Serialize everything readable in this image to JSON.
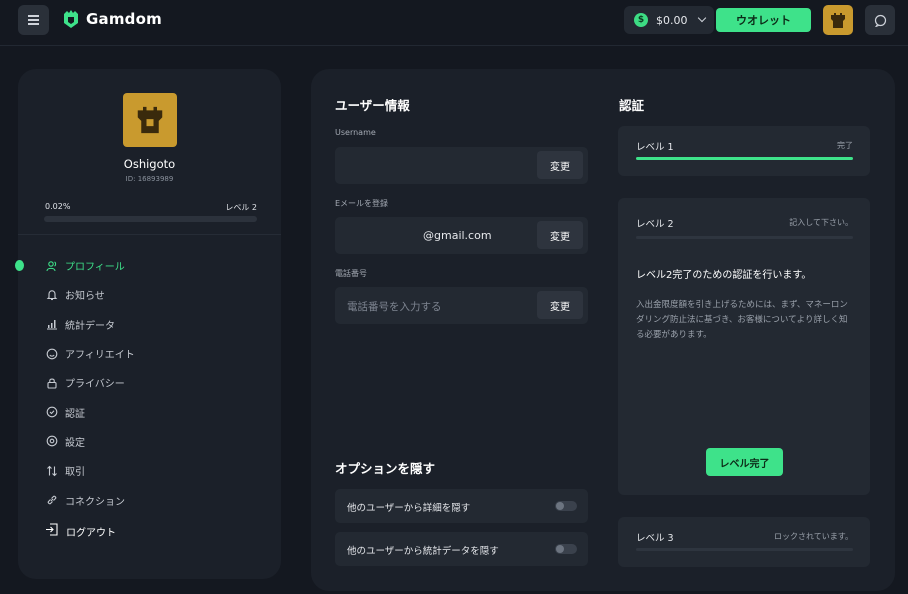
{
  "topbar": {
    "brand": "Gamdom",
    "balance": "$0.00",
    "coin_symbol": "$",
    "wallet_label": "ウオレット",
    "accent_color": "#3ee28a"
  },
  "profile": {
    "username": "Oshigoto",
    "user_id": "ID: 16893989",
    "progress_label": "0.02%",
    "progress_value": 0.02,
    "level_label": "レベル 2",
    "avatar_color": "#c99a2e"
  },
  "nav": {
    "items": [
      {
        "label": "プロフィール",
        "icon": "user-icon",
        "active": true
      },
      {
        "label": "お知らせ",
        "icon": "bell-icon"
      },
      {
        "label": "統計データ",
        "icon": "stats-icon"
      },
      {
        "label": "アフィリエイト",
        "icon": "smile-icon"
      },
      {
        "label": "プライバシー",
        "icon": "lock-icon"
      },
      {
        "label": "認証",
        "icon": "verify-icon"
      },
      {
        "label": "設定",
        "icon": "gear-icon"
      },
      {
        "label": "取引",
        "icon": "transfer-icon"
      },
      {
        "label": "コネクション",
        "icon": "link-icon"
      }
    ],
    "logout": "ログアウト"
  },
  "user_info": {
    "title": "ユーザー情報",
    "username_label": "Username",
    "username_value": "",
    "email_label": "Eメールを登録",
    "email_value": "@gmail.com",
    "phone_label": "電話番号",
    "phone_placeholder": "電話番号を入力する",
    "change_label": "変更"
  },
  "options": {
    "title": "オプションを隠す",
    "items": [
      {
        "label": "他のユーザーから詳細を隠す",
        "enabled": false
      },
      {
        "label": "他のユーザーから統計データを隠す",
        "enabled": false
      }
    ]
  },
  "verification": {
    "title": "認証",
    "level1": {
      "name": "レベル 1",
      "status": "完了",
      "progress": 1.0
    },
    "level2": {
      "name": "レベル 2",
      "status": "記入して下さい。",
      "progress": 0,
      "heading": "レベル2完了のための認証を行います。",
      "description": "入出金限度額を引き上げるためには、まず、マネーロンダリング防止法に基づき、お客様についてより詳しく知る必要があります。",
      "button": "レベル完了"
    },
    "level3": {
      "name": "レベル 3",
      "status": "ロックされています。",
      "progress": 0
    }
  }
}
